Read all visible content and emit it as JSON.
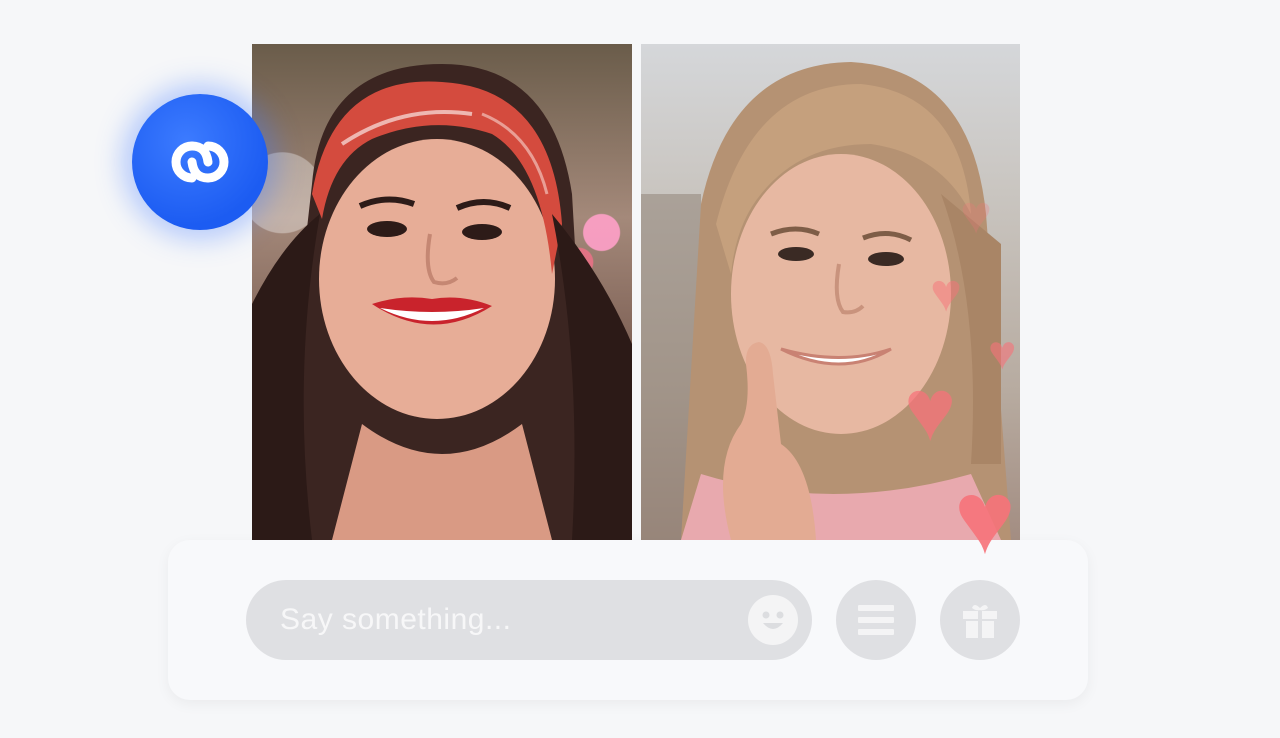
{
  "brand": {
    "logo_icon": "link-rings-icon",
    "accent_color": "#1f5ff3"
  },
  "video": {
    "left_participant": "woman-with-red-bandana",
    "right_participant": "woman-with-finger-on-lip"
  },
  "reactions": {
    "icon": "heart-icon",
    "color": "#f7737a"
  },
  "input": {
    "placeholder": "Say something...",
    "emoji_icon": "smiley-icon"
  },
  "actions": {
    "menu_icon": "menu-icon",
    "gift_icon": "gift-icon"
  }
}
